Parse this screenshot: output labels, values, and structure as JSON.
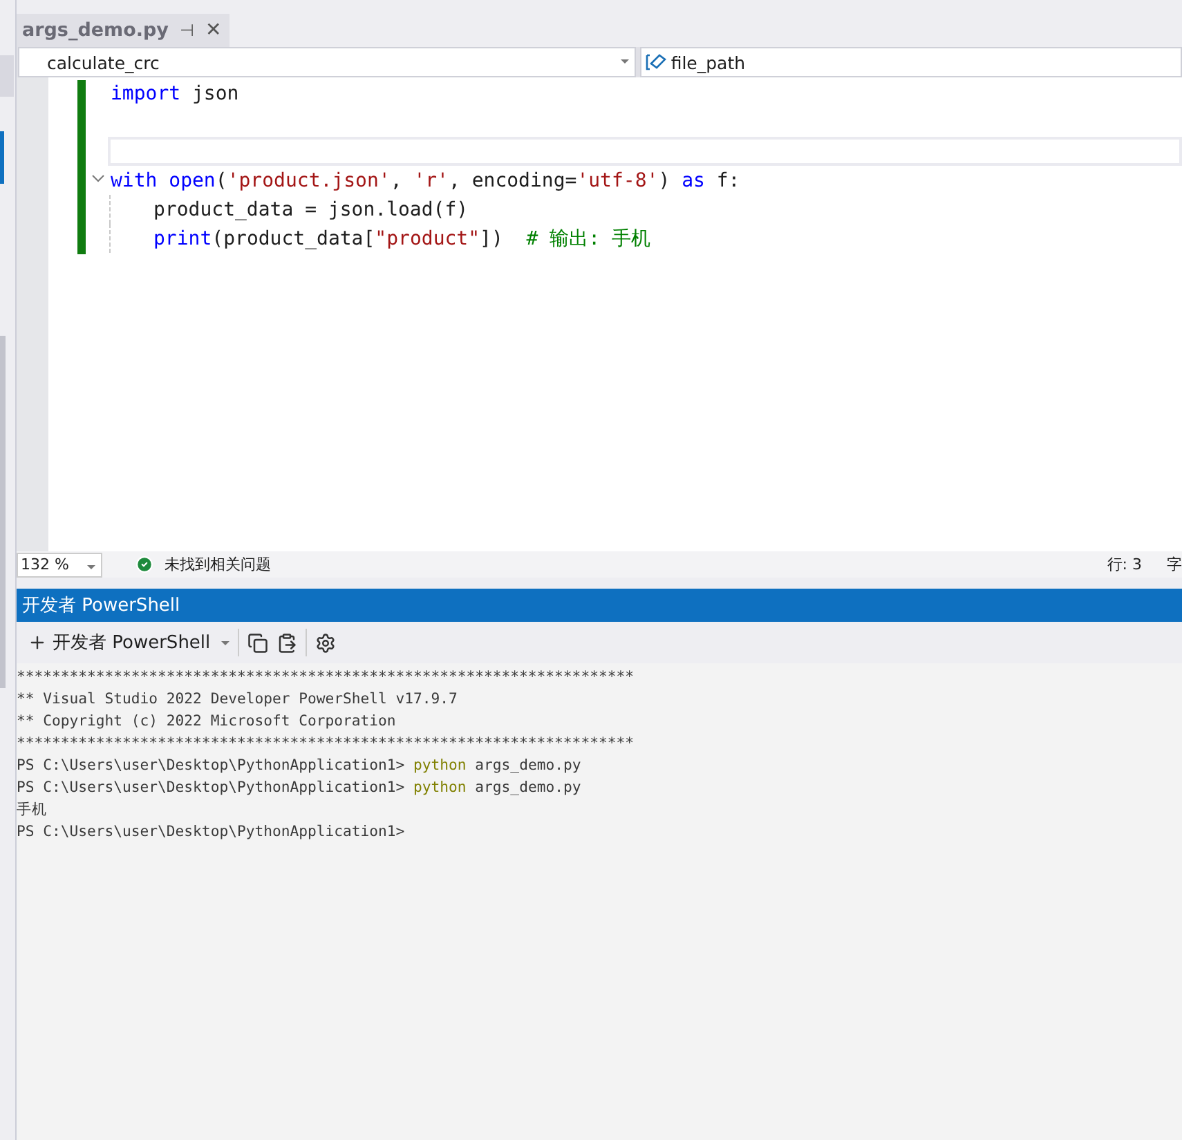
{
  "tab": {
    "title": "args_demo.py",
    "pin": "⊣",
    "close": "✕",
    "selected": true
  },
  "nav": {
    "scope": "calculate_crc",
    "member": "file_path"
  },
  "code": {
    "lines": [
      {
        "kind": "code",
        "tokens": [
          {
            "kind": "keyword",
            "text": "import"
          },
          {
            "kind": "plain",
            "text": " json"
          }
        ]
      },
      {
        "kind": "blank"
      },
      {
        "kind": "blank",
        "current": true
      },
      {
        "kind": "code",
        "fold": true,
        "tokens": [
          {
            "kind": "keyword",
            "text": "with"
          },
          {
            "kind": "keyword",
            "text": " open"
          },
          {
            "kind": "plain",
            "text": "("
          },
          {
            "kind": "string",
            "text": "'product.json'"
          },
          {
            "kind": "plain",
            "text": ", "
          },
          {
            "kind": "string",
            "text": "'r'"
          },
          {
            "kind": "plain",
            "text": ", encoding="
          },
          {
            "kind": "string",
            "text": "'utf-8'"
          },
          {
            "kind": "plain",
            "text": ") "
          },
          {
            "kind": "keyword",
            "text": "as"
          },
          {
            "kind": "plain",
            "text": " f:"
          }
        ]
      },
      {
        "kind": "code",
        "indent": true,
        "tokens": [
          {
            "kind": "plain",
            "text": "product_data = json.load(f)"
          }
        ]
      },
      {
        "kind": "code",
        "indent": true,
        "tokens": [
          {
            "kind": "keyword",
            "text": "print"
          },
          {
            "kind": "plain",
            "text": "(product_data["
          },
          {
            "kind": "string",
            "text": "\"product\""
          },
          {
            "kind": "plain",
            "text": "])  "
          },
          {
            "kind": "comment",
            "text": "# 输出: 手机"
          }
        ]
      }
    ]
  },
  "status": {
    "zoom": "132 %",
    "issues": "未找到相关问题",
    "line": "行: 3",
    "col": "字"
  },
  "terminal": {
    "title": "开发者 PowerShell",
    "profile": "开发者 PowerShell",
    "lines": [
      [
        {
          "kind": "plain",
          "text": "**********************************************************************"
        }
      ],
      [
        {
          "kind": "plain",
          "text": "** Visual Studio 2022 Developer PowerShell v17.9.7"
        }
      ],
      [
        {
          "kind": "plain",
          "text": "** Copyright (c) 2022 Microsoft Corporation"
        }
      ],
      [
        {
          "kind": "plain",
          "text": "**********************************************************************"
        }
      ],
      [
        {
          "kind": "plain",
          "text": "PS C:\\Users\\user\\Desktop\\PythonApplication1> "
        },
        {
          "kind": "command",
          "text": "python"
        },
        {
          "kind": "plain",
          "text": " args_demo.py"
        }
      ],
      [
        {
          "kind": "plain",
          "text": "PS C:\\Users\\user\\Desktop\\PythonApplication1> "
        },
        {
          "kind": "command",
          "text": "python"
        },
        {
          "kind": "plain",
          "text": " args_demo.py"
        }
      ],
      [
        {
          "kind": "plain",
          "text": "手机"
        }
      ],
      [
        {
          "kind": "plain",
          "text": "PS C:\\Users\\user\\Desktop\\PythonApplication1>"
        }
      ]
    ]
  }
}
